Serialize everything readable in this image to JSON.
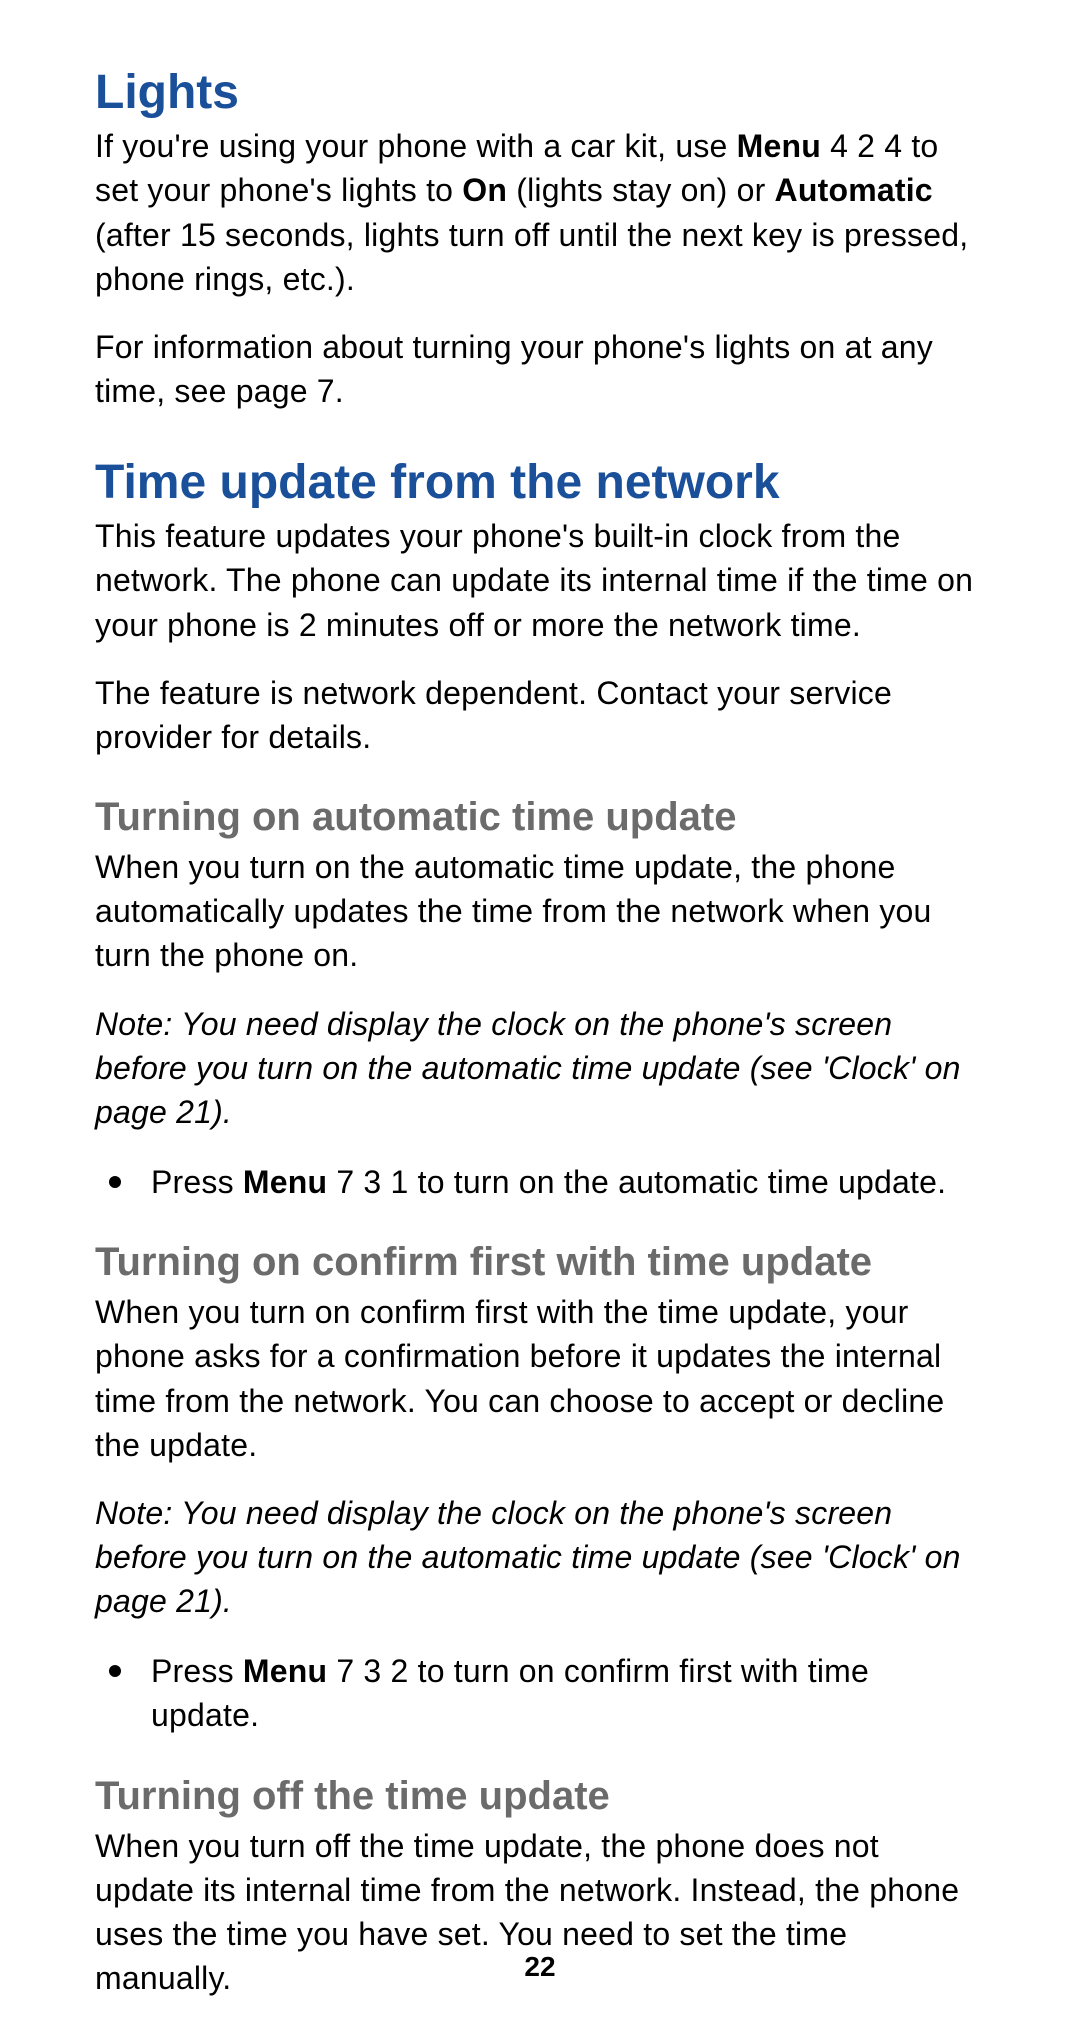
{
  "page_number": "22",
  "sections": {
    "lights": {
      "heading": "Lights",
      "p1_parts": [
        "If you're using your phone with a car kit, use ",
        "Menu",
        " 4 2 4 to set your phone's lights to ",
        "On",
        " (lights stay on) or ",
        "Automatic",
        " (after 15 seconds, lights turn off until the next key is pressed, phone rings, etc.)."
      ],
      "p2": "For information about turning your phone's lights on at any time, see page 7."
    },
    "time_update": {
      "heading": "Time update from the network",
      "p1": "This feature updates your phone's built-in clock from the network. The phone can update its internal time if the time on your phone is 2 minutes off or more the network time.",
      "p2": "The feature is network dependent. Contact your service provider for details."
    },
    "auto_on": {
      "heading": "Turning on automatic time update",
      "p1": "When you turn on the automatic time update, the phone automatically updates the time from the network when you turn the phone on.",
      "note": "Note: You need display the clock on the phone's screen before you turn on the automatic time update  (see 'Clock' on page 21).",
      "bullet_parts": [
        "Press ",
        "Menu",
        " 7 3 1 to turn on the automatic time update."
      ]
    },
    "confirm_first": {
      "heading": "Turning on confirm first with time update",
      "p1": "When you turn on confirm first with the time update, your phone asks for a confirmation before it updates the internal time from the network. You can choose to accept or decline the update.",
      "note": "Note: You need display the clock on the phone's screen before you turn on the automatic time update  (see 'Clock' on page 21).",
      "bullet_parts": [
        "Press ",
        "Menu",
        " 7 3 2 to turn on confirm first with time update."
      ]
    },
    "turn_off": {
      "heading": "Turning off the time update",
      "p1": "When you turn off the time update, the phone does not update its internal time from the network. Instead, the phone uses the time you have set. You need to set the time manually."
    }
  }
}
